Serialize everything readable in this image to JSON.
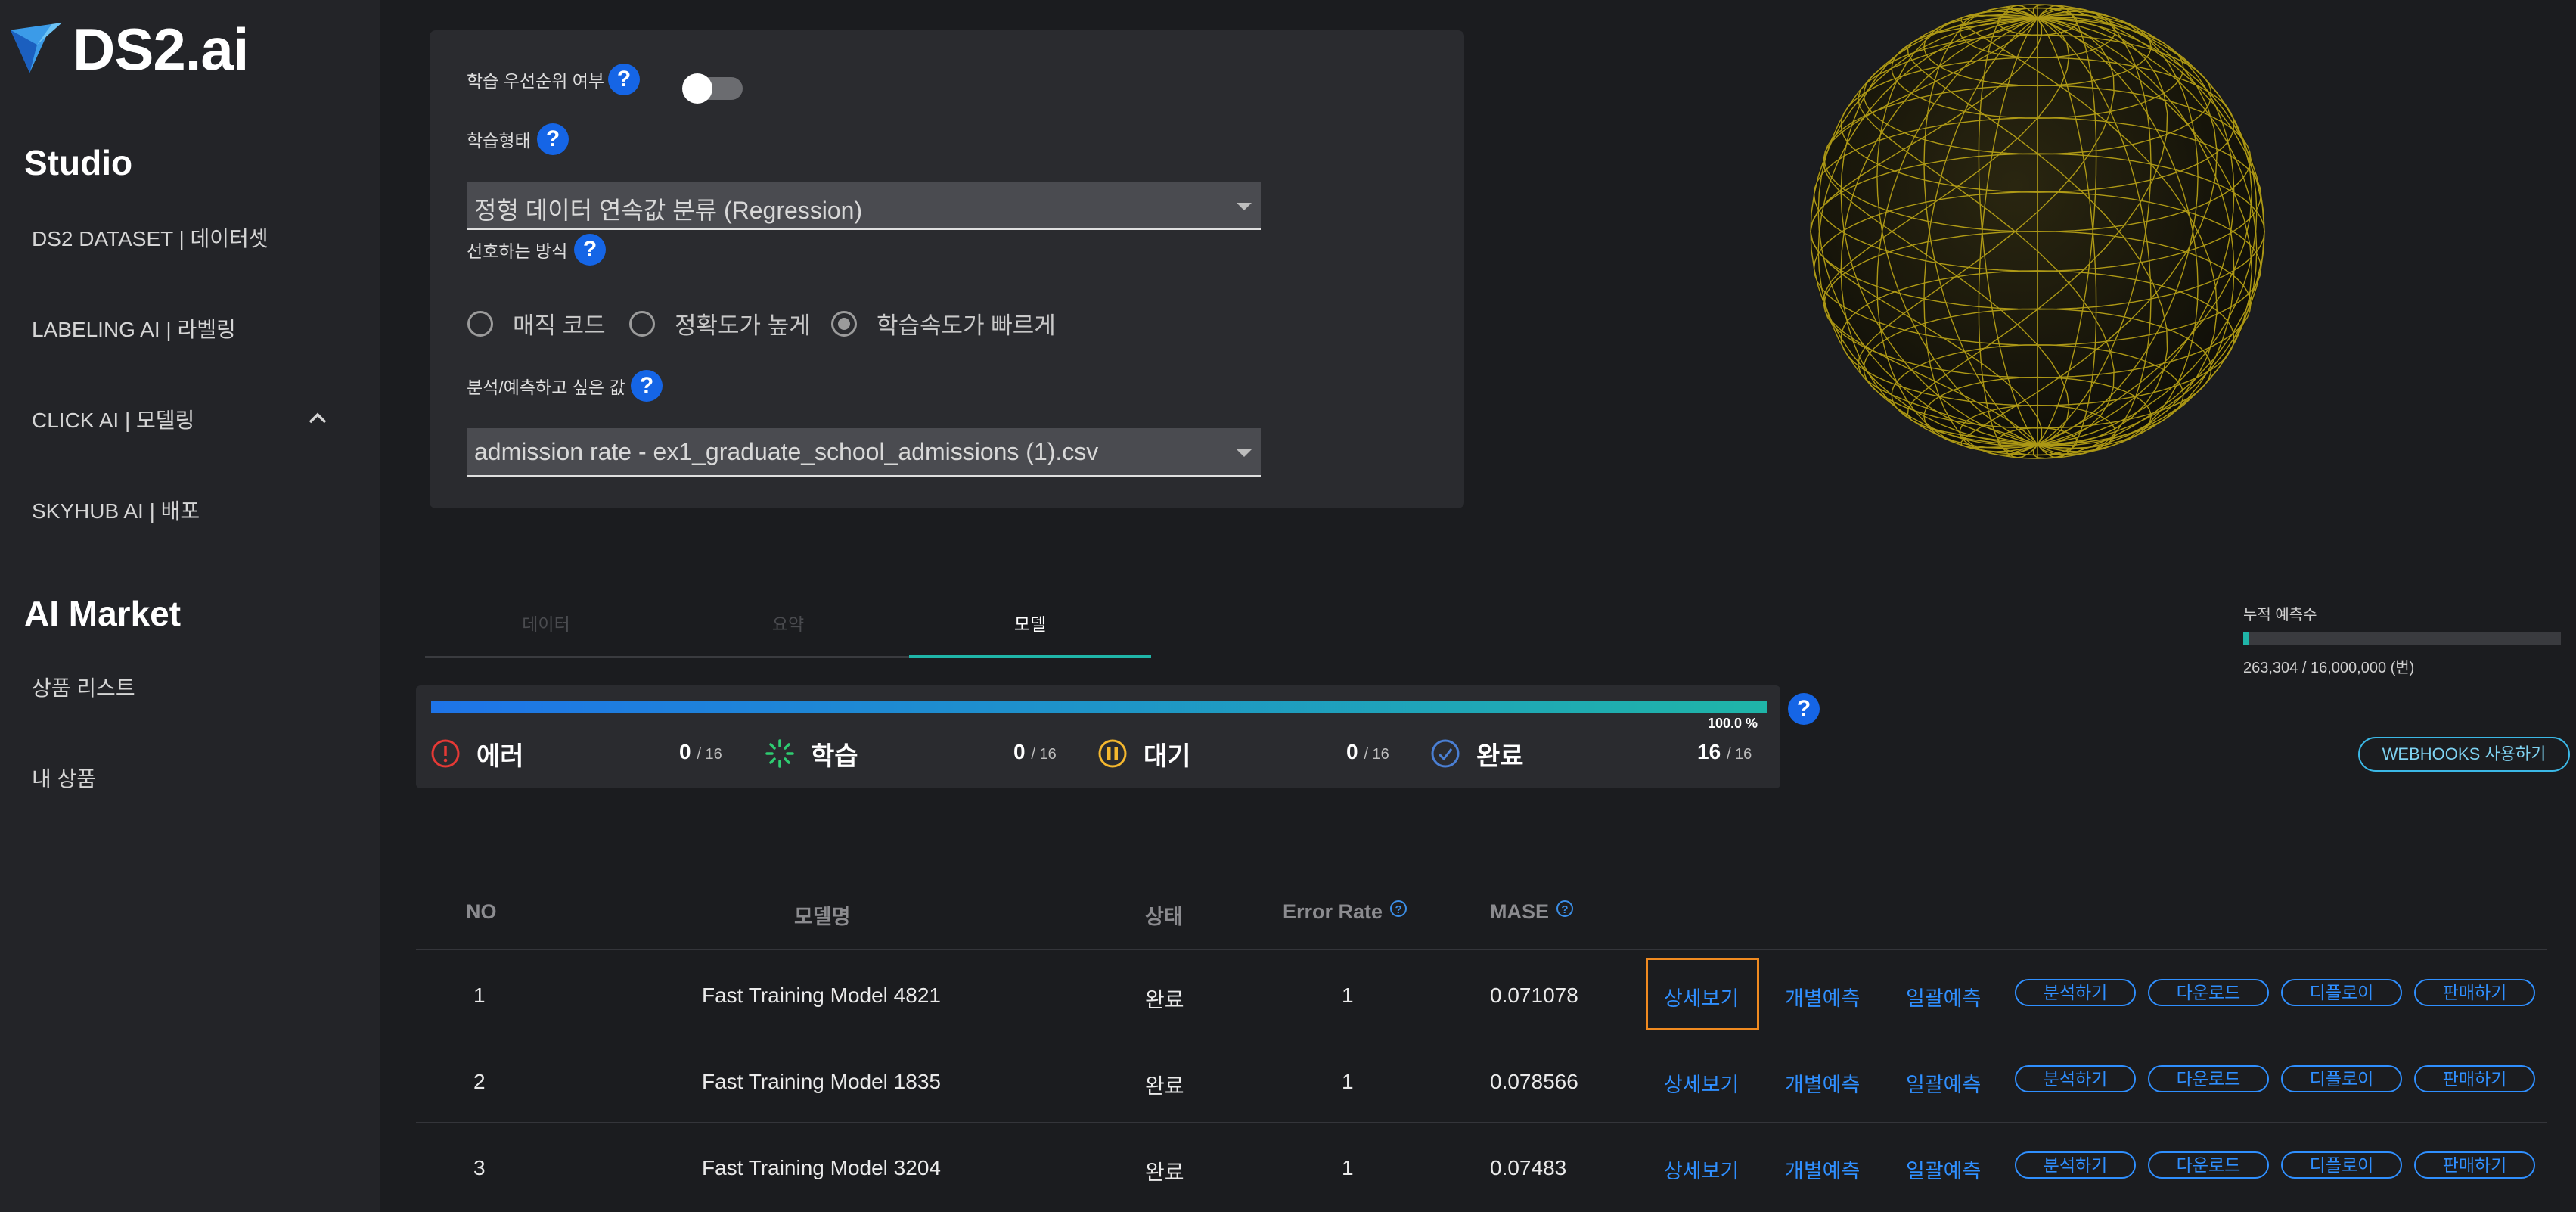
{
  "sidebar": {
    "logo": "DS2.ai",
    "section_studio": "Studio",
    "studio_items": [
      "DS2 DATASET | 데이터셋",
      "LABELING AI | 라벨링",
      "CLICK AI | 모델링",
      "SKYHUB AI | 배포"
    ],
    "section_market": "AI Market",
    "market_items": [
      "상품 리스트",
      "내 상품"
    ]
  },
  "settings": {
    "priority_label": "학습 우선순위 여부",
    "priority_enabled": false,
    "training_type_label": "학습형태",
    "training_type_value": "정형 데이터 연속값 분류 (Regression)",
    "preference_label": "선호하는 방식",
    "preference_options": [
      "매직 코드",
      "정확도가 높게",
      "학습속도가 빠르게"
    ],
    "preference_selected": "학습속도가 빠르게",
    "target_label": "분석/예측하고 싶은 값",
    "target_value": "admission rate - ex1_graduate_school_admissions (1).csv",
    "help_icon": "?"
  },
  "tabs": [
    "데이터",
    "요약",
    "모델"
  ],
  "active_tab": "모델",
  "cumulative": {
    "label": "누적 예측수",
    "value_text": "263,304 / 16,000,000 (번)",
    "fraction": 0.0165
  },
  "status": {
    "progress_text": "100.0 %",
    "progress_fraction": 1.0,
    "items": [
      {
        "label": "에러",
        "count": "0",
        "total": "/ 16",
        "icon": "error-icon",
        "color": "#e53935"
      },
      {
        "label": "학습",
        "count": "0",
        "total": "/ 16",
        "icon": "spinner-icon",
        "color": "#2ecc71"
      },
      {
        "label": "대기",
        "count": "0",
        "total": "/ 16",
        "icon": "pause-icon",
        "color": "#f5b82e"
      },
      {
        "label": "완료",
        "count": "16",
        "total": "/ 16",
        "icon": "check-icon",
        "color": "#4a7fd4"
      }
    ]
  },
  "webhooks_label": "WEBHOOKS 사용하기",
  "table": {
    "headers": {
      "no": "NO",
      "model": "모델명",
      "status": "상태",
      "error_rate": "Error Rate",
      "mase": "MASE",
      "help": "?"
    },
    "action_links": [
      "상세보기",
      "개별예측",
      "일괄예측"
    ],
    "action_buttons": [
      "분석하기",
      "다운로드",
      "디플로이",
      "판매하기"
    ],
    "rows": [
      {
        "no": "1",
        "model": "Fast Training Model 4821",
        "status": "완료",
        "error_rate": "1",
        "mase": "0.071078"
      },
      {
        "no": "2",
        "model": "Fast Training Model 1835",
        "status": "완료",
        "error_rate": "1",
        "mase": "0.078566"
      },
      {
        "no": "3",
        "model": "Fast Training Model 3204",
        "status": "완료",
        "error_rate": "1",
        "mase": "0.07483"
      }
    ]
  }
}
